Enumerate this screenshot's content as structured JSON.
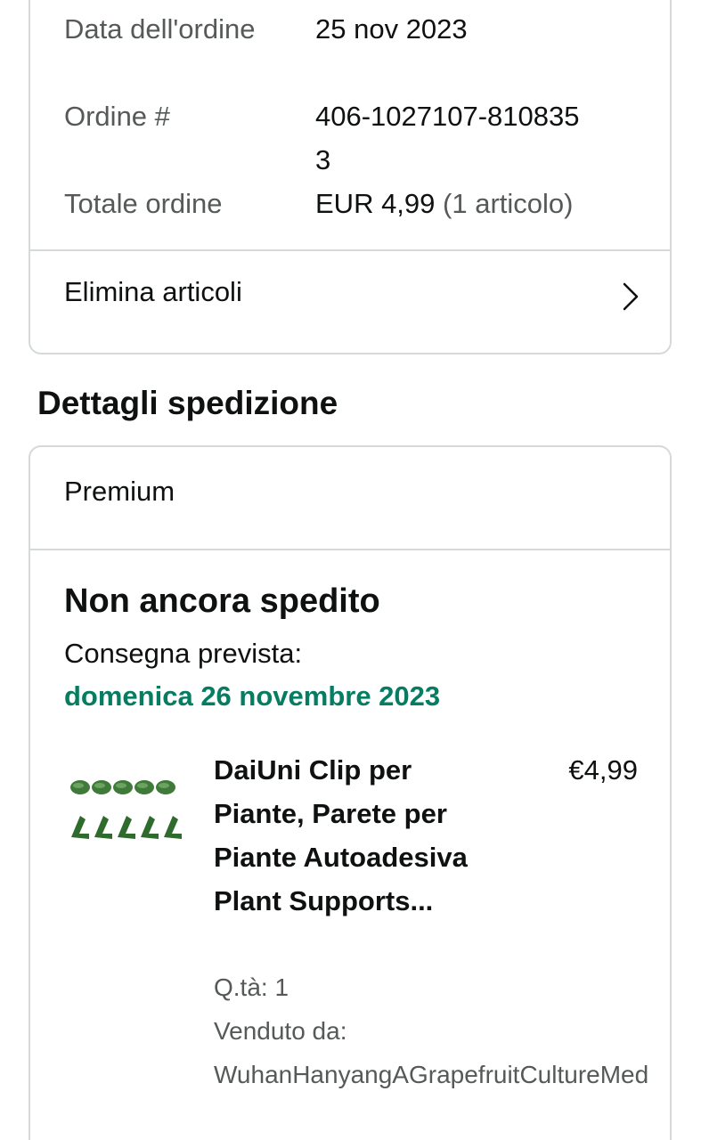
{
  "order_summary": {
    "rows": [
      {
        "label": "Data dell'ordine",
        "value": "25 nov 2023"
      },
      {
        "label": "Ordine #",
        "value": "406-1027107-8108353"
      },
      {
        "label": "Totale ordine",
        "value": "EUR 4,99",
        "value_extra": "(1 articolo)"
      }
    ],
    "remove_items_label": "Elimina articoli",
    "remove_items_icon": "chevron-right-icon"
  },
  "shipping": {
    "section_title": "Dettagli spedizione",
    "shipping_type": "Premium",
    "status": "Non ancora spedito",
    "delivery_label": "Consegna prevista:",
    "delivery_date": "domenica 26 novembre 2023",
    "delivery_date_color": "#067d62",
    "item": {
      "title": "DaiUni Clip per Piante, Parete per Piante Autoadesiva Plant Supports...",
      "price": "€4,99",
      "quantity": "Q.tà: 1",
      "sold_by_label": "Venduto da:",
      "seller": "WuhanHanyangAGrapefruitCultureMed"
    }
  }
}
